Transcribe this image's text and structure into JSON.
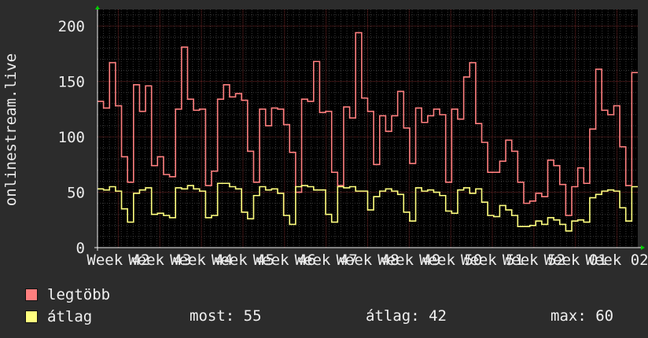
{
  "chart_data": {
    "type": "line",
    "ylabel": "onlinestream.live",
    "ylim": [
      0,
      215
    ],
    "yticks": [
      0,
      50,
      100,
      150,
      200
    ],
    "ytick_labels": [
      "0",
      "50",
      "100",
      "150",
      "200"
    ],
    "xticks": [
      "Week 42",
      "Week 43",
      "Week 44",
      "Week 45",
      "Week 46",
      "Week 47",
      "Week 48",
      "Week 49",
      "Week 50",
      "Week 51",
      "Week 52",
      "Week 01",
      "Week 02"
    ],
    "grid": true,
    "legend_placement": "bottom-left",
    "series": [
      {
        "name": "legtöbb",
        "color": "#ff7f7f",
        "values": [
          132,
          126,
          167,
          128,
          82,
          59,
          147,
          123,
          146,
          74,
          82,
          66,
          64,
          125,
          181,
          134,
          124,
          125,
          56,
          69,
          134,
          147,
          136,
          139,
          133,
          87,
          59,
          125,
          110,
          126,
          125,
          111,
          86,
          50,
          134,
          132,
          168,
          122,
          123,
          68,
          56,
          127,
          117,
          194,
          135,
          123,
          75,
          119,
          105,
          119,
          141,
          108,
          76,
          126,
          113,
          119,
          125,
          120,
          59,
          125,
          116,
          154,
          167,
          112,
          95,
          68,
          68,
          78,
          97,
          87,
          59,
          40,
          42,
          49,
          46,
          79,
          74,
          57,
          29,
          55,
          72,
          58,
          107,
          161,
          124,
          120,
          128,
          91,
          56,
          158
        ],
        "interval_count": 90
      },
      {
        "name": "átlag",
        "color": "#ffff7f",
        "values": [
          53,
          52,
          55,
          51,
          35,
          23,
          49,
          52,
          54,
          30,
          31,
          29,
          27,
          54,
          53,
          56,
          53,
          51,
          27,
          29,
          58,
          58,
          55,
          53,
          32,
          26,
          47,
          55,
          52,
          53,
          49,
          29,
          21,
          55,
          56,
          55,
          52,
          52,
          30,
          23,
          55,
          54,
          55,
          51,
          51,
          34,
          46,
          51,
          53,
          51,
          48,
          32,
          24,
          54,
          51,
          52,
          50,
          47,
          33,
          31,
          52,
          54,
          49,
          53,
          41,
          29,
          28,
          38,
          34,
          29,
          19,
          19,
          20,
          24,
          21,
          27,
          25,
          21,
          15,
          24,
          25,
          23,
          45,
          48,
          51,
          52,
          51,
          36,
          24,
          55
        ],
        "interval_count": 90
      }
    ],
    "stats": {
      "now_label": "most:",
      "now_value": "55",
      "avg_label": "átlag:",
      "avg_value": "42",
      "max_label": "max:",
      "max_value": "60"
    }
  }
}
